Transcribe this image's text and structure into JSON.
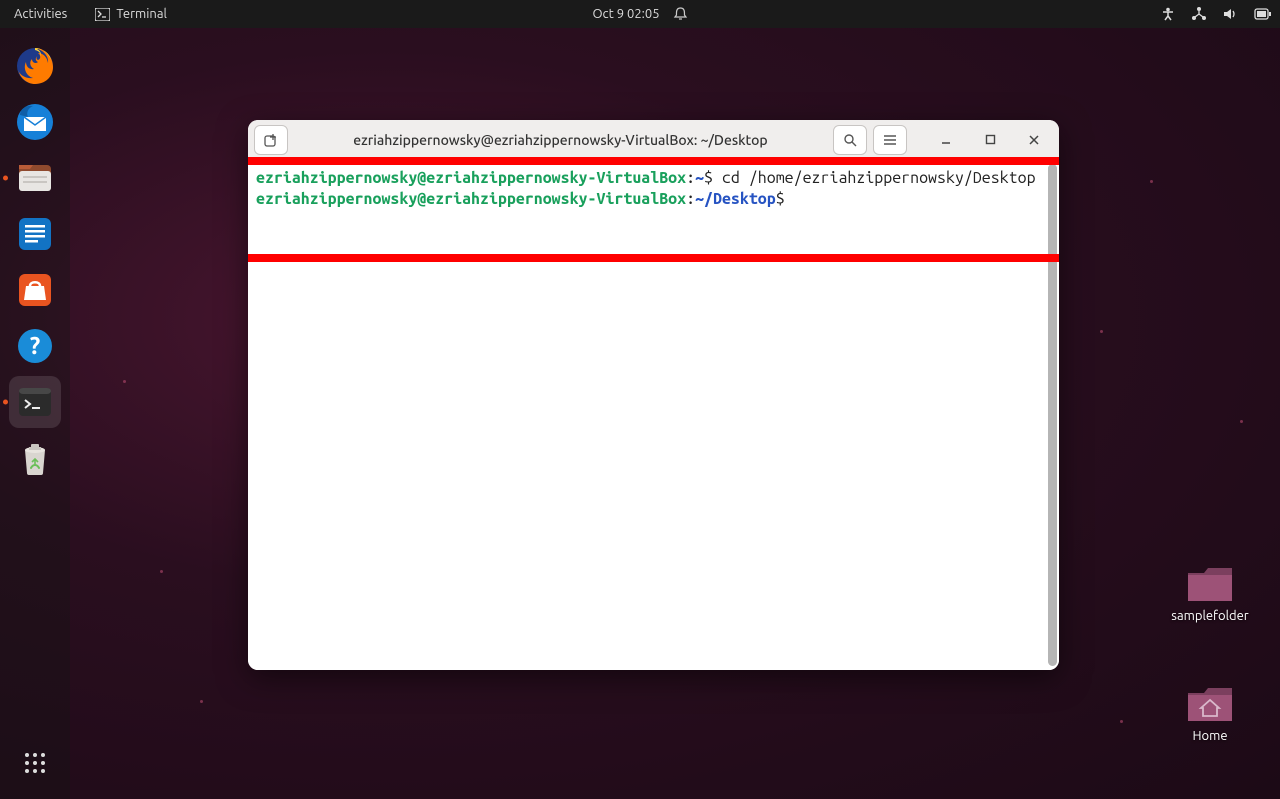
{
  "topbar": {
    "activities": "Activities",
    "app_label": "Terminal",
    "datetime": "Oct 9  02:05"
  },
  "dock": {
    "firefox": "Firefox",
    "thunderbird": "Thunderbird",
    "files": "Files",
    "writer": "LibreOffice Writer",
    "software": "Ubuntu Software",
    "help": "Help",
    "terminal": "Terminal",
    "trash": "Trash",
    "apps": "Show Applications"
  },
  "desktop": {
    "folder1": "samplefolder",
    "home": "Home"
  },
  "window": {
    "title": "ezriahzippernowsky@ezriahzippernowsky-VirtualBox: ~/Desktop",
    "newtab_tooltip": "New Tab",
    "search_tooltip": "Search",
    "menu_tooltip": "Menu",
    "min_tooltip": "Minimize",
    "max_tooltip": "Maximize",
    "close_tooltip": "Close"
  },
  "terminal": {
    "line1_userhost": "ezriahzippernowsky@ezriahzippernowsky-VirtualBox",
    "line1_sep": ":",
    "line1_path": "~",
    "line1_prompt": "$",
    "line1_cmd": " cd /home/ezriahzippernowsky/Desktop",
    "line2_userhost": "ezriahzippernowsky@ezriahzippernowsky-VirtualBox",
    "line2_sep": ":",
    "line2_path": "~/Desktop",
    "line2_prompt": "$",
    "line2_cmd": " "
  }
}
